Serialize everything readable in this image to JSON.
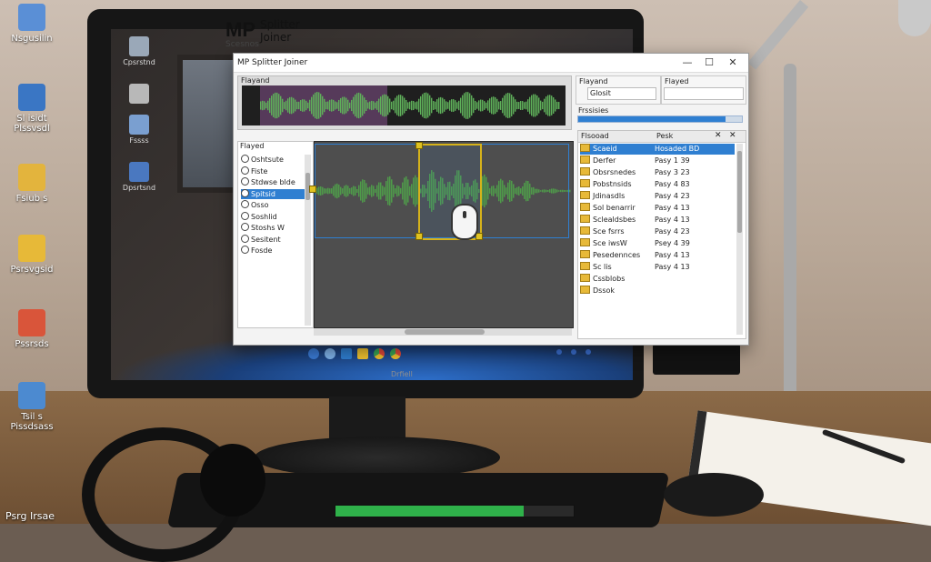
{
  "app": {
    "window_title": "MP Splitter Joiner",
    "logo_mp": "MP",
    "logo_line1": "Splitter",
    "logo_line2": "Joiner",
    "logo_sub": "Scesnos",
    "controls": {
      "minimize": "—",
      "maximize": "☐",
      "close": "✕"
    }
  },
  "overview": {
    "label": "Flayand"
  },
  "right_top": {
    "panel1_label": "Flayand",
    "panel1_field": "Glosit",
    "panel2_label": "Flayed",
    "progress_label": "Frssisies",
    "progress": 0.9
  },
  "left_list": {
    "header": "Flayed",
    "items": [
      {
        "label": "Oshtsute",
        "selected": false
      },
      {
        "label": "Fiste",
        "selected": false
      },
      {
        "label": "Stdwse blde",
        "selected": false
      },
      {
        "label": "Spitsid",
        "selected": true
      },
      {
        "label": "Osso",
        "selected": false
      },
      {
        "label": "Soshlid",
        "selected": false
      },
      {
        "label": "Stoshs W",
        "selected": false
      },
      {
        "label": "Sesitent",
        "selected": false
      },
      {
        "label": "Fosde",
        "selected": false
      }
    ]
  },
  "file_pane": {
    "col_name": "Flsooad",
    "col_date": "Pesk",
    "rows": [
      {
        "name": "Scaeid",
        "date": "Hosaded BD",
        "selected": true
      },
      {
        "name": "Derfer",
        "date": "Pasy 1 39",
        "selected": false
      },
      {
        "name": "Obsrsnedes",
        "date": "Pasy 3 23",
        "selected": false
      },
      {
        "name": "Pobstnsids",
        "date": "Pasy 4 83",
        "selected": false
      },
      {
        "name": "Jdinasdls",
        "date": "Pasy 4 23",
        "selected": false
      },
      {
        "name": "Sol benarrir",
        "date": "Pasy 4 13",
        "selected": false
      },
      {
        "name": "Sclealdsbes",
        "date": "Pasy 4 13",
        "selected": false
      },
      {
        "name": "Sce fsrrs",
        "date": "Pasy 4 23",
        "selected": false
      },
      {
        "name": "Sce iwsW",
        "date": "Psey 4 39",
        "selected": false
      },
      {
        "name": "Pesedennces",
        "date": "Pasy 4 13",
        "selected": false
      },
      {
        "name": "Sc lis",
        "date": "Pasy 4 13",
        "selected": false
      },
      {
        "name": "Cssblobs",
        "date": "",
        "selected": false
      },
      {
        "name": "Dssok",
        "date": "",
        "selected": false
      }
    ]
  },
  "desktop_icons": [
    {
      "label": "Nsgusilin",
      "color": "#5a8fd6"
    },
    {
      "label": "Sl isidt\nPlssvsdl",
      "color": "#3a76c4"
    },
    {
      "label": "Fsiub s",
      "color": "#e3b43d"
    },
    {
      "label": "Psrsvgsid",
      "color": "#e7b938"
    },
    {
      "label": "Pssrsds",
      "color": "#d9553a"
    },
    {
      "label": "Tsil s\nPissdsass",
      "color": "#4c8ad0"
    }
  ],
  "screen_icons": [
    {
      "label": "Cpsrstnd",
      "color": "#9aa8b8"
    },
    {
      "label": "",
      "color": "#b8b8b8"
    },
    {
      "label": "Fssss",
      "color": "#7a9fd0"
    },
    {
      "label": "Dpsrtsnd",
      "color": "#4a78c0"
    }
  ],
  "monitor_brand": "Drfiell",
  "bottom_status": {
    "label": "Psrg Irsae",
    "progress": 0.79
  }
}
